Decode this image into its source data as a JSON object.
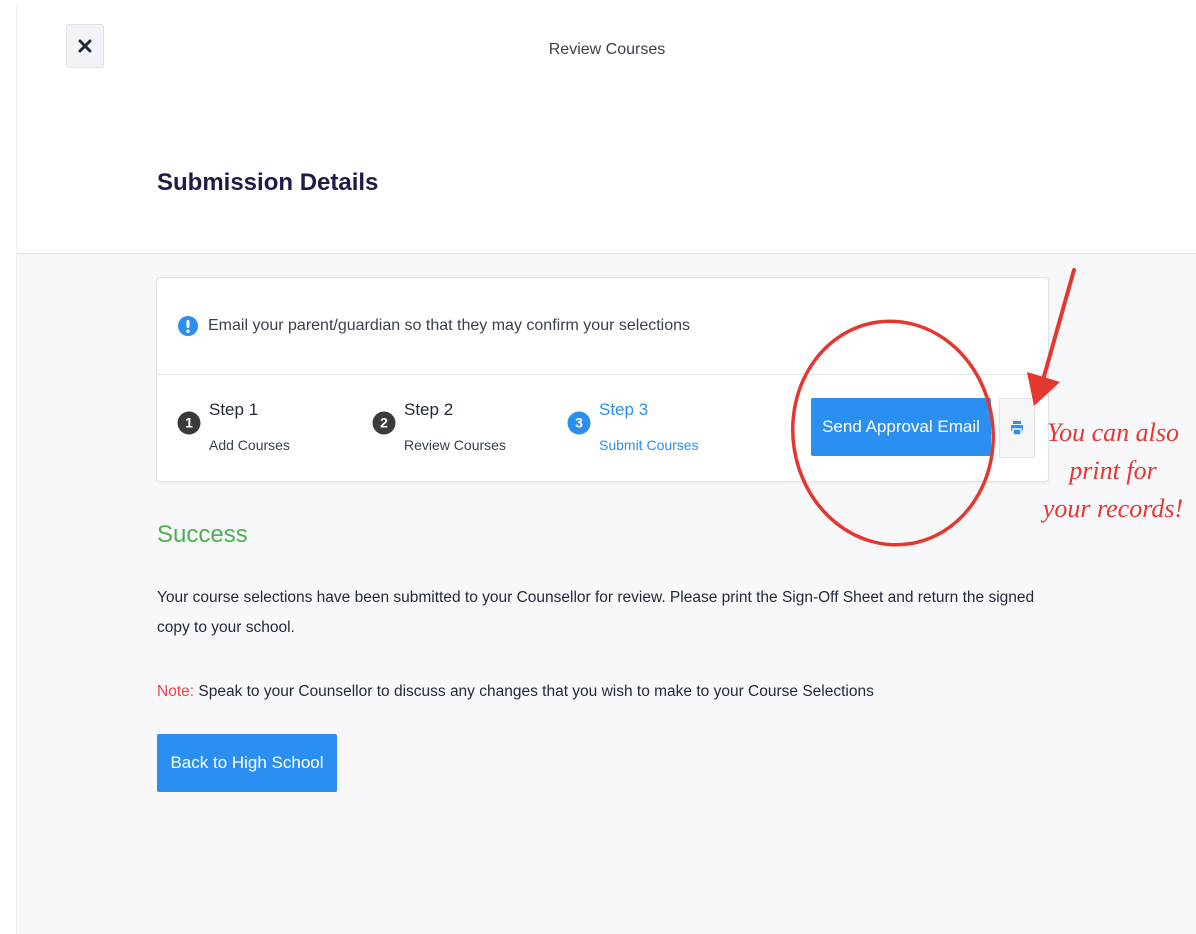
{
  "topbar": {
    "title": "Review Courses",
    "close_icon": "close-x-icon"
  },
  "header": {
    "title": "Submission Details"
  },
  "notice": {
    "icon": "info-icon",
    "text": "Email your parent/guardian so that they may confirm your selections"
  },
  "steps": [
    {
      "number": "1",
      "title": "Step 1",
      "subtitle": "Add Courses",
      "active": false
    },
    {
      "number": "2",
      "title": "Step 2",
      "subtitle": "Review Courses",
      "active": false
    },
    {
      "number": "3",
      "title": "Step 3",
      "subtitle": "Submit Courses",
      "active": true
    }
  ],
  "actions": {
    "send_label": "Send Approval Email",
    "print_icon": "print-icon"
  },
  "success": {
    "title": "Success",
    "message": "Your course selections have been submitted to your Counsellor for review. Please print the Sign-Off Sheet and return the signed copy to your school.",
    "note_label": "Note:",
    "note_text": " Speak to your Counsellor to discuss any changes that you wish to make to your Course Selections",
    "back_label": "Back to High School"
  },
  "annotation": {
    "text_lines": [
      "You can also",
      "print for",
      "your records!"
    ]
  },
  "colors": {
    "primary": "#2a8ff0",
    "success": "#4caf50",
    "note": "#ef4444",
    "annotation": "#e4372f",
    "title": "#1e1b4b",
    "step_inactive": "#3a3a3a"
  }
}
